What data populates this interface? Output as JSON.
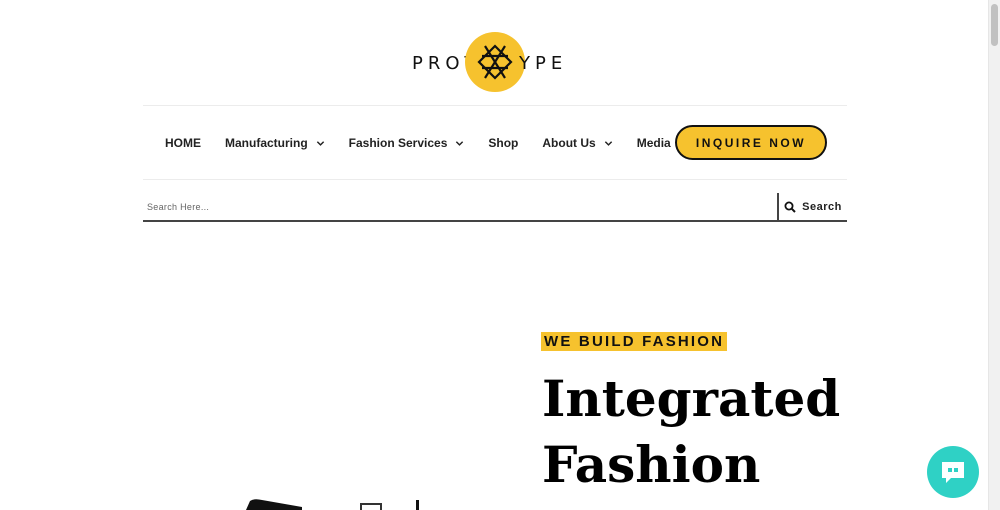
{
  "logo": {
    "left": "PROT",
    "right": "YPE"
  },
  "nav": {
    "items": [
      {
        "label": "HOME",
        "has_dropdown": false
      },
      {
        "label": "Manufacturing",
        "has_dropdown": true
      },
      {
        "label": "Fashion Services",
        "has_dropdown": true
      },
      {
        "label": "Shop",
        "has_dropdown": false
      },
      {
        "label": "About Us",
        "has_dropdown": true
      },
      {
        "label": "Media",
        "has_dropdown": true
      }
    ],
    "cta_label": "INQUIRE NOW"
  },
  "search": {
    "placeholder": "Search Here...",
    "value": "",
    "button_label": "Search",
    "icon": "search-icon"
  },
  "hero": {
    "tagline": "WE BUILD FASHION",
    "headline_line1": "Integrated",
    "headline_line2": "Fashion"
  },
  "chat": {
    "icon": "chat-icon"
  },
  "colors": {
    "brand_yellow": "#f6c22e",
    "chat_teal": "#2fd1c5",
    "text_dark": "#111111"
  }
}
